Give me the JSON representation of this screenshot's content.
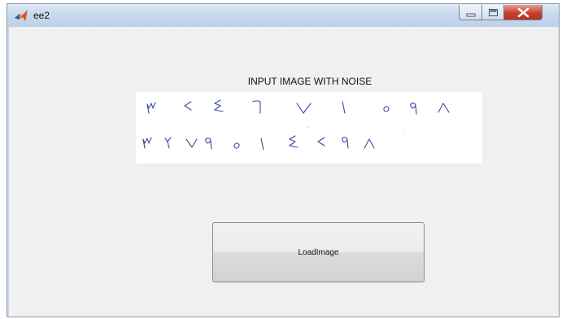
{
  "window": {
    "title": "ee2",
    "icon": "matlab-figure-icon",
    "controls": [
      "minimize-icon",
      "maximize-icon",
      "close-icon"
    ]
  },
  "main": {
    "heading": "INPUT IMAGE WITH NOISE",
    "image": {
      "row1": [
        "٣",
        "٢",
        "٤",
        "٦",
        "٧",
        "١",
        "٥",
        "٩",
        "٨"
      ],
      "row2": [
        "٣",
        "٢",
        "٧",
        "٩",
        "٥",
        "١",
        "٤",
        "٢",
        "٩",
        "٨"
      ],
      "ink_color": "#3a46a6"
    },
    "load_button_label": "LoadImage"
  },
  "colors": {
    "window_frame": "#c8d8ea",
    "client_background": "#f0f0f0",
    "close_button": "#c7422c"
  }
}
